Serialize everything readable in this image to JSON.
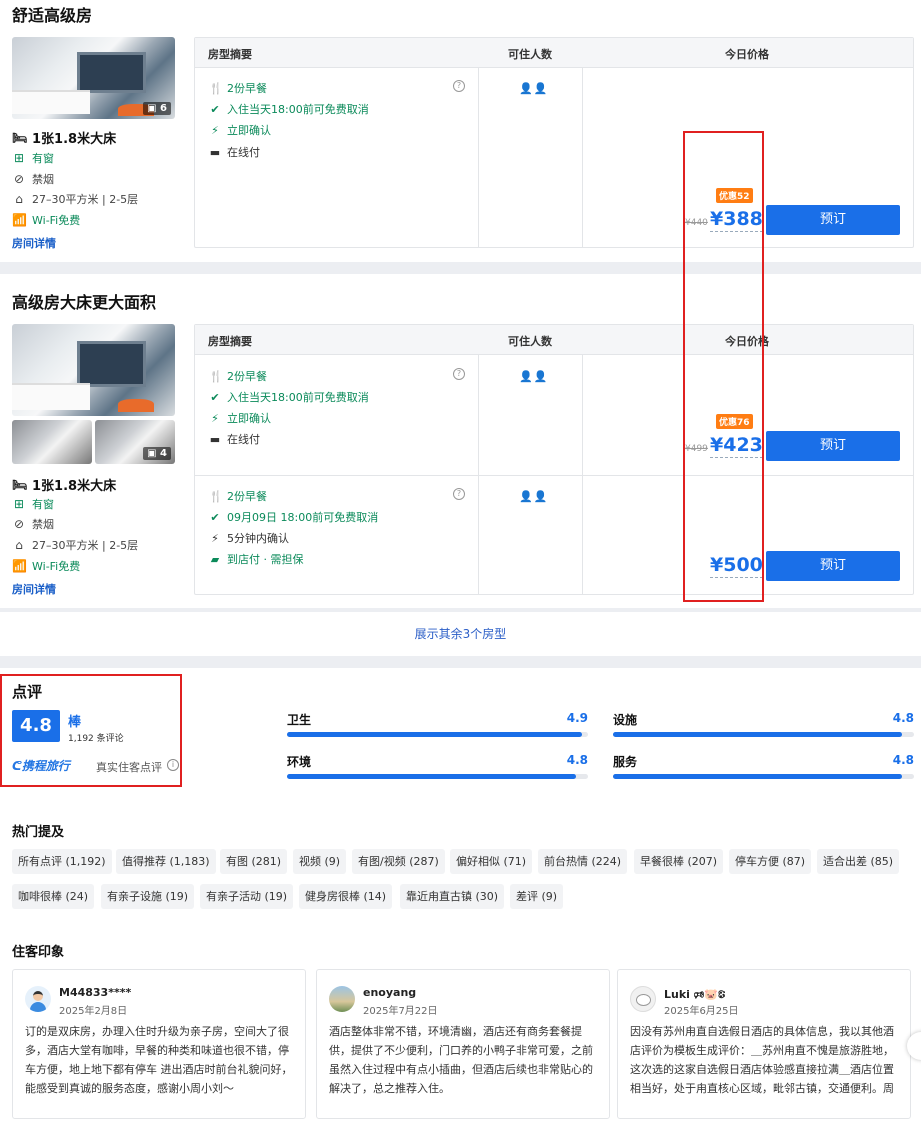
{
  "colors": {
    "accent": "#1a6fe8",
    "green": "#0b8a5a",
    "discount": "#ff7d13",
    "highlight_box": "#e02020"
  },
  "table_headers": {
    "summary": "房型摘要",
    "guests": "可住人数",
    "price": "今日价格"
  },
  "rooms": [
    {
      "title": "舒适高级房",
      "image_count": "6",
      "features": {
        "bed": "1张1.8米大床",
        "window": "有窗",
        "smoking": "禁烟",
        "area": "27–30平方米 | 2-5层",
        "wifi": "Wi-Fi免费"
      },
      "detail_link": "房间详情",
      "offers": [
        {
          "breakfast": "2份早餐",
          "cancel": "入住当天18:00前可免费取消",
          "confirm": "立即确认",
          "payment": "在线付",
          "guests": "👤👤",
          "discount": "优惠52",
          "old_price": "¥440",
          "price": "¥388",
          "book": "预订"
        }
      ]
    },
    {
      "title": "高级房大床更大面积",
      "image_count": "4",
      "features": {
        "bed": "1张1.8米大床",
        "window": "有窗",
        "smoking": "禁烟",
        "area": "27–30平方米 | 2-5层",
        "wifi": "Wi-Fi免费"
      },
      "detail_link": "房间详情",
      "offers": [
        {
          "breakfast": "2份早餐",
          "cancel": "入住当天18:00前可免费取消",
          "confirm": "立即确认",
          "payment": "在线付",
          "guests": "👤👤",
          "discount": "优惠76",
          "old_price": "¥499",
          "price": "¥423",
          "book": "预订"
        },
        {
          "breakfast": "2份早餐",
          "cancel": "09月09日 18:00前可免费取消",
          "confirm": "5分钟内确认",
          "payment": "到店付 · 需担保",
          "guests": "👤👤",
          "price": "¥500",
          "book": "预订"
        }
      ]
    }
  ],
  "show_more": "展示其余3个房型",
  "reviews": {
    "title": "点评",
    "score": "4.8",
    "score_word": "棒",
    "count": "1,192 条评论",
    "brand": "携程旅行",
    "real_review": "真实住客点评",
    "categories": [
      {
        "name": "卫生",
        "score": "4.9",
        "ratio": 0.98
      },
      {
        "name": "设施",
        "score": "4.8",
        "ratio": 0.96
      },
      {
        "name": "环境",
        "score": "4.8",
        "ratio": 0.96
      },
      {
        "name": "服务",
        "score": "4.8",
        "ratio": 0.96
      }
    ],
    "hot_title": "热门提及",
    "tags": [
      "所有点评 (1,192)",
      "值得推荐 (1,183)",
      "有图 (281)",
      "视频 (9)",
      "有图/视频 (287)",
      "偏好相似 (71)",
      "前台热情 (224)",
      "早餐很棒 (207)",
      "停车方便 (87)",
      "适合出差 (85)",
      "咖啡很棒 (24)",
      "有亲子设施 (19)",
      "有亲子活动 (19)",
      "健身房很棒 (14)",
      "靠近甪直古镇 (30)",
      "差评 (9)"
    ],
    "impression_title": "住客印象",
    "cards": [
      {
        "name": "M44833****",
        "date": "2025年2月8日",
        "text": "订的是双床房，办理入住时升级为亲子房，空间大了很多，酒店大堂有咖啡，早餐的种类和味道也很不错，停车方便，地上地下都有停车 进出酒店时前台礼貌问好，能感受到真诚的服务态度，感谢小周小刘～"
      },
      {
        "name": "enoyang",
        "date": "2025年7月22日",
        "text": "酒店整体非常不错，环境清幽，酒店还有商务套餐提供，提供了不少便利，门口养的小鸭子非常可爱，之前虽然入住过程中有点小插曲，但酒店后续也非常贴心的解决了，总之推荐入住。"
      },
      {
        "name": "Luki 🕫🐷🕃",
        "date": "2025年6月25日",
        "text": "因没有苏州甪直自选假日酒店的具体信息，我以其他酒店评价为模板生成评价：＿苏州甪直不愧是旅游胜地，这次选的这家自选假日酒店体验感直接拉满＿酒店位置相当好，处于甪直核心区域，毗邻古镇，交通便利。周边不仅有热闹的商业街，还有很多特色小..."
      }
    ]
  }
}
